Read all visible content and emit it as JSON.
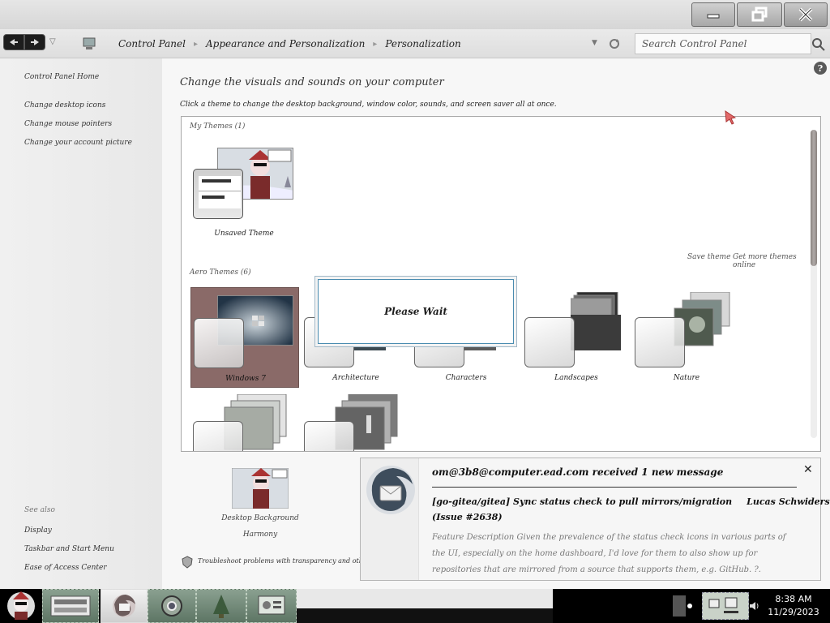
{
  "window": {
    "breadcrumbs": [
      "Control Panel",
      "Appearance and Personalization",
      "Personalization"
    ],
    "search_placeholder": "Search Control Panel"
  },
  "sidebar": {
    "home": "Control Panel Home",
    "links": [
      "Change desktop icons",
      "Change mouse pointers",
      "Change your account picture"
    ],
    "see_also_label": "See also",
    "see_also": [
      "Display",
      "Taskbar and Start Menu",
      "Ease of Access Center"
    ]
  },
  "main": {
    "title": "Change the visuals and sounds on your computer",
    "description": "Click a theme to change the desktop background, window color, sounds, and screen saver all at once.",
    "my_themes_label": "My Themes (1)",
    "unsaved_theme": "Unsaved Theme",
    "save_theme": "Save theme",
    "get_more_themes": "Get more themes online",
    "aero_themes_label": "Aero Themes (6)",
    "themes": [
      "Windows 7",
      "Architecture",
      "Characters",
      "Landscapes",
      "Nature"
    ],
    "please_wait": "Please Wait",
    "desktop_background_label": "Desktop Background",
    "desktop_background_value": "Harmony",
    "troubleshoot": "Troubleshoot problems with transparency and other Aero effects"
  },
  "notification": {
    "title": "om@3b8@computer.ead.com received 1 new message",
    "subject": "[go-gitea/gitea] Sync status check to pull mirrors/migration",
    "author": "Lucas Schwiderski",
    "issue": "(Issue #2638)",
    "preview": "Feature Description Given the prevalence of the status check icons in various parts of the UI, especially on the home dashboard, I'd love for them to also show up for repositories that are mirrored from a source that supports them, e.g. GitHub. ?.",
    "close_glyph": "✕"
  },
  "taskbar": {
    "time": "8:38 AM",
    "date": "11/29/2023"
  },
  "icons": {
    "minimize": "minimize-icon",
    "maximize": "restore-icon",
    "close": "close-icon",
    "back": "back-arrow-icon",
    "forward": "forward-arrow-icon",
    "search": "search-icon",
    "refresh": "refresh-icon",
    "help": "help-icon",
    "shield": "shield-icon"
  }
}
